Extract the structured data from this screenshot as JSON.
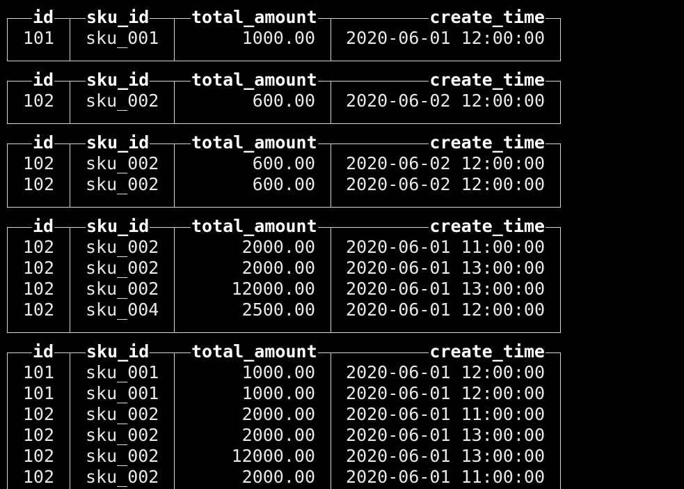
{
  "terminal": {
    "columns": [
      "id",
      "sku_id",
      "total_amount",
      "create_time"
    ],
    "result_sets": [
      {
        "rows": [
          [
            "101",
            "sku_001",
            "1000.00",
            "2020-06-01 12:00:00"
          ]
        ]
      },
      {
        "rows": [
          [
            "102",
            "sku_002",
            "600.00",
            "2020-06-02 12:00:00"
          ]
        ]
      },
      {
        "rows": [
          [
            "102",
            "sku_002",
            "600.00",
            "2020-06-02 12:00:00"
          ],
          [
            "102",
            "sku_002",
            "600.00",
            "2020-06-02 12:00:00"
          ]
        ]
      },
      {
        "rows": [
          [
            "102",
            "sku_002",
            "2000.00",
            "2020-06-01 11:00:00"
          ],
          [
            "102",
            "sku_002",
            "2000.00",
            "2020-06-01 13:00:00"
          ],
          [
            "102",
            "sku_002",
            "12000.00",
            "2020-06-01 13:00:00"
          ],
          [
            "102",
            "sku_004",
            "2500.00",
            "2020-06-01 12:00:00"
          ]
        ]
      },
      {
        "rows": [
          [
            "101",
            "sku_001",
            "1000.00",
            "2020-06-01 12:00:00"
          ],
          [
            "101",
            "sku_001",
            "1000.00",
            "2020-06-01 12:00:00"
          ],
          [
            "102",
            "sku_002",
            "2000.00",
            "2020-06-01 11:00:00"
          ],
          [
            "102",
            "sku_002",
            "2000.00",
            "2020-06-01 13:00:00"
          ],
          [
            "102",
            "sku_002",
            "12000.00",
            "2020-06-01 13:00:00"
          ],
          [
            "102",
            "sku_002",
            "2000.00",
            "2020-06-01 11:00:00"
          ]
        ]
      }
    ]
  }
}
